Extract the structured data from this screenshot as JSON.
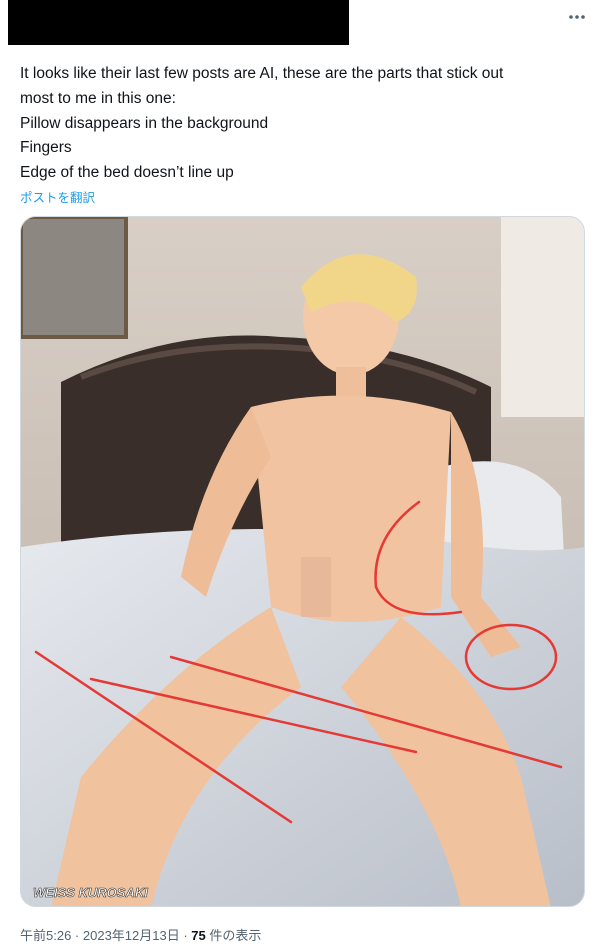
{
  "tweet": {
    "lines": [
      "It looks like their last few posts are AI, these are the parts that stick out",
      "most to me in this one:",
      "Pillow disappears in the background",
      "Fingers",
      "Edge of the bed doesn’t line up"
    ],
    "translate_label": "ポストを翻訳"
  },
  "media": {
    "watermark": "WEISS KUROSAKI"
  },
  "meta": {
    "time": "午前5:26",
    "sep1": " · ",
    "date": "2023年12月13日",
    "sep2": " · ",
    "views_count": "75",
    "views_label": " 件の表示"
  },
  "colors": {
    "link": "#1d9bf0",
    "text": "#0f1419",
    "secondary": "#536471",
    "annotation": "#e53935"
  },
  "icons": {
    "more": "more-horizontal-icon"
  }
}
